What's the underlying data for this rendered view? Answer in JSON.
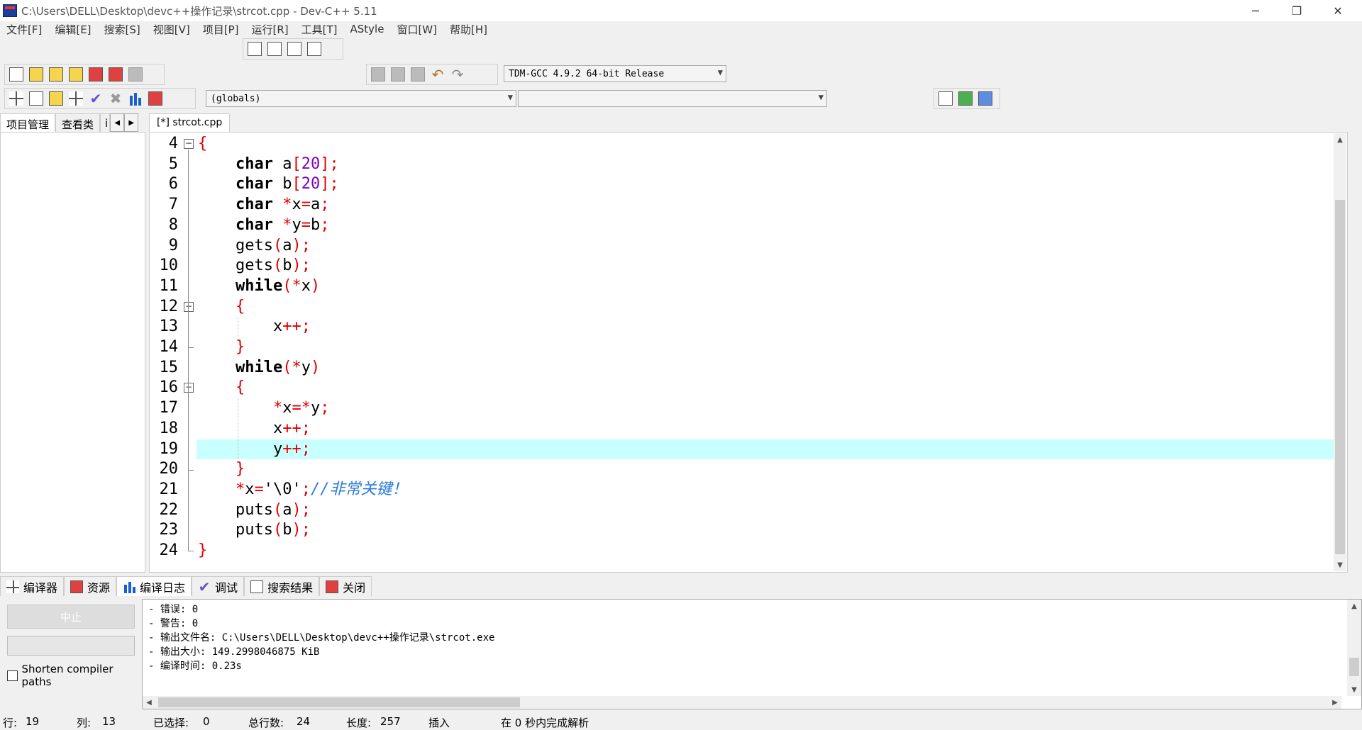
{
  "window": {
    "title": "C:\\Users\\DELL\\Desktop\\devc++操作记录\\strcot.cpp - Dev-C++ 5.11",
    "min_icon": "─",
    "max_icon": "❐",
    "close_icon": "✕"
  },
  "menu": [
    "文件[F]",
    "编辑[E]",
    "搜索[S]",
    "视图[V]",
    "项目[P]",
    "运行[R]",
    "工具[T]",
    "AStyle",
    "窗口[W]",
    "帮助[H]"
  ],
  "toolbar": {
    "compiler_select": "TDM-GCC 4.9.2 64-bit Release",
    "scope_select": "(globals)",
    "member_select": ""
  },
  "left_panel": {
    "tabs": [
      "项目管理",
      "查看类",
      "i"
    ],
    "nav_prev": "◀",
    "nav_next": "▶"
  },
  "editor": {
    "tab_label": "[*] strcot.cpp",
    "current_line": 19,
    "lines": [
      {
        "n": "4",
        "tokens": [
          {
            "t": "{",
            "c": "sym"
          }
        ]
      },
      {
        "n": "5",
        "tokens": [
          {
            "t": "    "
          },
          {
            "t": "char",
            "c": "kw"
          },
          {
            "t": " a"
          },
          {
            "t": "[",
            "c": "sym"
          },
          {
            "t": "20",
            "c": "num"
          },
          {
            "t": "];",
            "c": "sym"
          }
        ]
      },
      {
        "n": "6",
        "tokens": [
          {
            "t": "    "
          },
          {
            "t": "char",
            "c": "kw"
          },
          {
            "t": " b"
          },
          {
            "t": "[",
            "c": "sym"
          },
          {
            "t": "20",
            "c": "num"
          },
          {
            "t": "];",
            "c": "sym"
          }
        ]
      },
      {
        "n": "7",
        "tokens": [
          {
            "t": "    "
          },
          {
            "t": "char",
            "c": "kw"
          },
          {
            "t": " "
          },
          {
            "t": "*",
            "c": "sym"
          },
          {
            "t": "x"
          },
          {
            "t": "=",
            "c": "sym"
          },
          {
            "t": "a"
          },
          {
            "t": ";",
            "c": "sym"
          }
        ]
      },
      {
        "n": "8",
        "tokens": [
          {
            "t": "    "
          },
          {
            "t": "char",
            "c": "kw"
          },
          {
            "t": " "
          },
          {
            "t": "*",
            "c": "sym"
          },
          {
            "t": "y"
          },
          {
            "t": "=",
            "c": "sym"
          },
          {
            "t": "b"
          },
          {
            "t": ";",
            "c": "sym"
          }
        ]
      },
      {
        "n": "9",
        "tokens": [
          {
            "t": "    gets"
          },
          {
            "t": "(",
            "c": "sym"
          },
          {
            "t": "a"
          },
          {
            "t": ");",
            "c": "sym"
          }
        ]
      },
      {
        "n": "10",
        "tokens": [
          {
            "t": "    gets"
          },
          {
            "t": "(",
            "c": "sym"
          },
          {
            "t": "b"
          },
          {
            "t": ");",
            "c": "sym"
          }
        ]
      },
      {
        "n": "11",
        "tokens": [
          {
            "t": "    "
          },
          {
            "t": "while",
            "c": "kw"
          },
          {
            "t": "(*",
            "c": "sym"
          },
          {
            "t": "x"
          },
          {
            "t": ")",
            "c": "sym"
          }
        ]
      },
      {
        "n": "12",
        "tokens": [
          {
            "t": "    "
          },
          {
            "t": "{",
            "c": "sym"
          }
        ]
      },
      {
        "n": "13",
        "tokens": [
          {
            "t": "        x"
          },
          {
            "t": "++;",
            "c": "sym"
          }
        ]
      },
      {
        "n": "14",
        "tokens": [
          {
            "t": "    "
          },
          {
            "t": "}",
            "c": "sym"
          }
        ]
      },
      {
        "n": "15",
        "tokens": [
          {
            "t": "    "
          },
          {
            "t": "while",
            "c": "kw"
          },
          {
            "t": "(*",
            "c": "sym"
          },
          {
            "t": "y"
          },
          {
            "t": ")",
            "c": "sym"
          }
        ]
      },
      {
        "n": "16",
        "tokens": [
          {
            "t": "    "
          },
          {
            "t": "{",
            "c": "sym"
          }
        ]
      },
      {
        "n": "17",
        "tokens": [
          {
            "t": "        "
          },
          {
            "t": "*",
            "c": "sym"
          },
          {
            "t": "x"
          },
          {
            "t": "=*",
            "c": "sym"
          },
          {
            "t": "y"
          },
          {
            "t": ";",
            "c": "sym"
          }
        ]
      },
      {
        "n": "18",
        "tokens": [
          {
            "t": "        x"
          },
          {
            "t": "++;",
            "c": "sym"
          }
        ]
      },
      {
        "n": "19",
        "tokens": [
          {
            "t": "        y"
          },
          {
            "t": "++;",
            "c": "sym"
          }
        ]
      },
      {
        "n": "20",
        "tokens": [
          {
            "t": "    "
          },
          {
            "t": "}",
            "c": "sym"
          }
        ]
      },
      {
        "n": "21",
        "tokens": [
          {
            "t": "    "
          },
          {
            "t": "*",
            "c": "sym"
          },
          {
            "t": "x"
          },
          {
            "t": "=",
            "c": "sym"
          },
          {
            "t": "'\\0'"
          },
          {
            "t": ";",
            "c": "sym"
          },
          {
            "t": "//非常关键！",
            "c": "cmt"
          }
        ]
      },
      {
        "n": "22",
        "tokens": [
          {
            "t": "    puts"
          },
          {
            "t": "(",
            "c": "sym"
          },
          {
            "t": "a"
          },
          {
            "t": ");",
            "c": "sym"
          }
        ]
      },
      {
        "n": "23",
        "tokens": [
          {
            "t": "    puts"
          },
          {
            "t": "(",
            "c": "sym"
          },
          {
            "t": "b"
          },
          {
            "t": ");",
            "c": "sym"
          }
        ]
      },
      {
        "n": "24",
        "tokens": [
          {
            "t": "}",
            "c": "sym"
          }
        ]
      }
    ],
    "fold_markers": [
      {
        "n": "4",
        "kind": "box"
      },
      {
        "n": "12",
        "kind": "box"
      },
      {
        "n": "14",
        "kind": "end"
      },
      {
        "n": "16",
        "kind": "box"
      },
      {
        "n": "20",
        "kind": "end"
      },
      {
        "n": "24",
        "kind": "end"
      }
    ],
    "scroll_up": "▲",
    "scroll_down": "▼"
  },
  "bottom_tabs": [
    {
      "label": "编译器",
      "icon": "grid-icon"
    },
    {
      "label": "资源",
      "icon": "resources-icon"
    },
    {
      "label": "编译日志",
      "icon": "bar-chart-icon",
      "active": true
    },
    {
      "label": "调试",
      "icon": "check-icon"
    },
    {
      "label": "搜索结果",
      "icon": "search-icon"
    },
    {
      "label": "关闭",
      "icon": "close-icon"
    }
  ],
  "compile_panel": {
    "abort_label": "中止",
    "shorten_label": "Shorten compiler paths",
    "log": [
      "- 错误: 0",
      "- 警告: 0",
      "- 输出文件名: C:\\Users\\DELL\\Desktop\\devc++操作记录\\strcot.exe",
      "- 输出大小: 149.2998046875 KiB",
      "- 编译时间: 0.23s"
    ],
    "hscroll_left": "◀",
    "hscroll_right": "▶"
  },
  "status": {
    "row_label": "行:",
    "row_value": "19",
    "col_label": "列:",
    "col_value": "13",
    "sel_label": "已选择:",
    "sel_value": "0",
    "lines_label": "总行数:",
    "lines_value": "24",
    "len_label": "长度:",
    "len_value": "257",
    "mode": "插入",
    "parse": "在 0 秒内完成解析"
  },
  "colors": {
    "current_line": "#c8ffff",
    "symbol": "#e00000",
    "number": "#8000c0",
    "comment": "#2a7bd6"
  }
}
